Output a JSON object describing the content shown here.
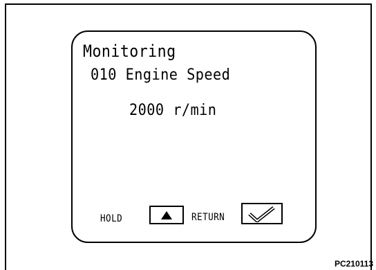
{
  "monitor": {
    "title": "Monitoring",
    "item": "010 Engine Speed",
    "value": "2000 r/min"
  },
  "controls": {
    "hold_label": "HOLD",
    "hold_icon": "up-triangle-icon",
    "return_label": "RETURN",
    "return_icon": "checkmark-icon"
  },
  "figure_code": "PC210113"
}
